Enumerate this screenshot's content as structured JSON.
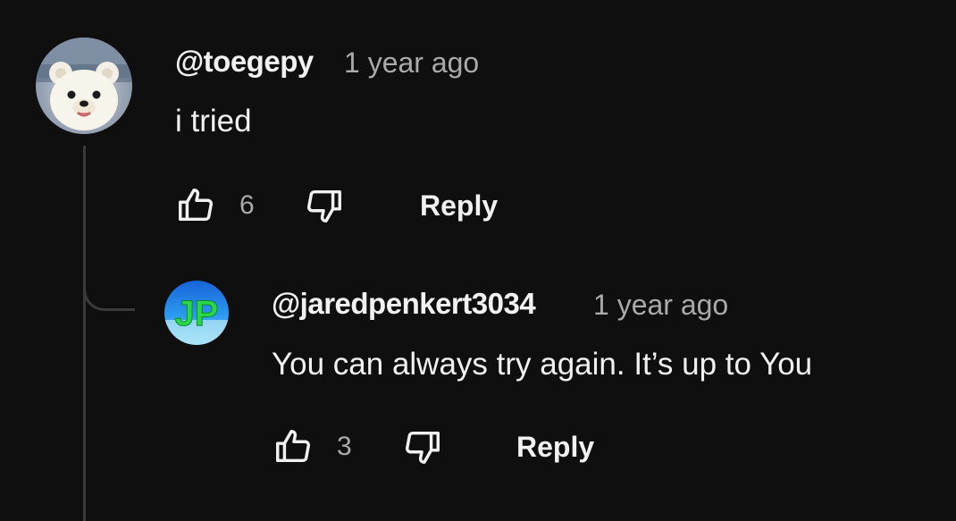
{
  "comments": [
    {
      "author": "@toegepy",
      "timestamp": "1 year ago",
      "text": "i tried",
      "likes": "6",
      "reply_label": "Reply",
      "avatar_icon": "teddy-bear-avatar"
    },
    {
      "author": "@jaredpenkert3034",
      "timestamp": "1 year ago",
      "text": "You can always try again. It’s up to You",
      "likes": "3",
      "reply_label": "Reply",
      "avatar_icon": "jp-monogram-avatar"
    }
  ],
  "colors": {
    "background": "#0f0f0f",
    "primary_text": "#f1f1f1",
    "secondary_text": "#aaaaaa",
    "thread_line": "#3a3a3a"
  }
}
